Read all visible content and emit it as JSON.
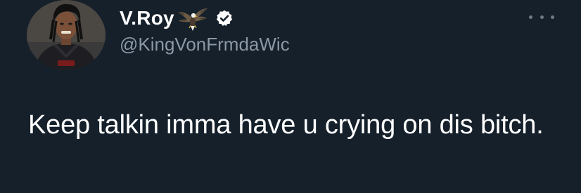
{
  "tweet": {
    "author": {
      "display_name": "V.Roy",
      "name_emoji": "eagle",
      "verified": true,
      "handle": "@KingVonFrmdaWic"
    },
    "text": "Keep talkin imma have u crying on dis bitch."
  },
  "icons": {
    "avatar": "avatar",
    "name_emoji": "eagle-icon",
    "verified": "verified-badge-icon",
    "more": "more-options-icon"
  },
  "colors": {
    "background": "#15202b",
    "primary_text": "#ffffff",
    "secondary_text": "#8b98a5",
    "verified_badge": "#ffffff"
  }
}
